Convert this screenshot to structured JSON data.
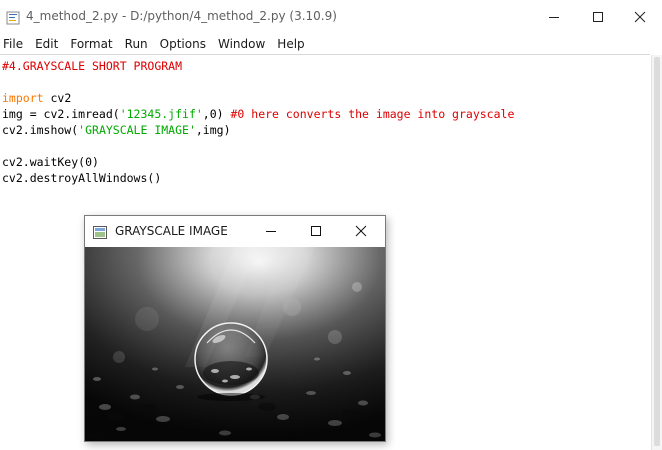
{
  "window": {
    "title": "4_method_2.py - D:/python/4_method_2.py (3.10.9)",
    "icon": "python-idle-icon"
  },
  "menu": [
    "File",
    "Edit",
    "Format",
    "Run",
    "Options",
    "Window",
    "Help"
  ],
  "code": [
    [
      {
        "t": "#4.GRAYSCALE SHORT PROGRAM",
        "k": "comment"
      }
    ],
    [],
    [
      {
        "t": "import",
        "k": "keyword"
      },
      {
        "t": " cv2",
        "k": "plain"
      }
    ],
    [
      {
        "t": "img = cv2.imread(",
        "k": "plain"
      },
      {
        "t": "'12345.jfif'",
        "k": "string"
      },
      {
        "t": ",0) ",
        "k": "plain"
      },
      {
        "t": "#0 here converts the image into grayscale",
        "k": "comment"
      }
    ],
    [
      {
        "t": "cv2.imshow(",
        "k": "plain"
      },
      {
        "t": "'GRAYSCALE IMAGE'",
        "k": "string"
      },
      {
        "t": ",img)",
        "k": "plain"
      }
    ],
    [],
    [
      {
        "t": "cv2.waitKey(0)",
        "k": "plain"
      }
    ],
    [
      {
        "t": "cv2.destroyAllWindows()",
        "k": "plain"
      }
    ]
  ],
  "image_window": {
    "title": "GRAYSCALE IMAGE",
    "image_description_icon": "grayscale-water-bubble-photo"
  },
  "colors": {
    "comment": "#dd0000",
    "keyword": "#ff7700",
    "string": "#00aa00"
  }
}
